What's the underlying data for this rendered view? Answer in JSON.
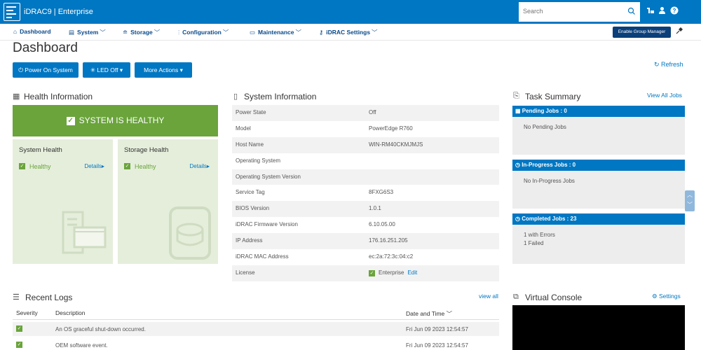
{
  "header": {
    "brand": "iDRAC9 | Enterprise",
    "search_placeholder": "Search"
  },
  "nav": [
    {
      "label": "Dashboard",
      "icon": "home-icon"
    },
    {
      "label": "System",
      "icon": "server-icon"
    },
    {
      "label": "Storage",
      "icon": "database-icon"
    },
    {
      "label": "Configuration",
      "icon": "sliders-icon"
    },
    {
      "label": "Maintenance",
      "icon": "monitor-icon"
    },
    {
      "label": "iDRAC Settings",
      "icon": "key-icon"
    }
  ],
  "enable_group_manager": "Enable Group Manager",
  "page_title": "Dashboard",
  "actions": {
    "power": "Power On System",
    "led": "LED Off",
    "more": "More Actions",
    "refresh": "Refresh"
  },
  "health": {
    "title": "Health Information",
    "banner": "SYSTEM IS HEALTHY",
    "system_health": {
      "title": "System Health",
      "status": "Healthy",
      "details": "Details"
    },
    "storage_health": {
      "title": "Storage Health",
      "status": "Healthy",
      "details": "Details"
    }
  },
  "system_info": {
    "title": "System Information",
    "rows": [
      {
        "key": "Power State",
        "value": "Off"
      },
      {
        "key": "Model",
        "value": "PowerEdge R760"
      },
      {
        "key": "Host Name",
        "value": "WIN-RM40CKMJMJS"
      },
      {
        "key": "Operating System",
        "value": ""
      },
      {
        "key": "Operating System Version",
        "value": ""
      },
      {
        "key": "Service Tag",
        "value": "8FXG6S3"
      },
      {
        "key": "BIOS Version",
        "value": "1.0.1"
      },
      {
        "key": "iDRAC Firmware Version",
        "value": "6.10.05.00"
      },
      {
        "key": "IP Address",
        "value": "176.16.251.205"
      },
      {
        "key": "iDRAC MAC Address",
        "value": "ec:2a:72:3c:04:c2"
      }
    ],
    "license_key": "License",
    "license_value": "Enterprise",
    "license_edit": "Edit"
  },
  "tasks": {
    "title": "Task Summary",
    "view_all": "View All Jobs",
    "pending_title": "Pending Jobs : 0",
    "pending_body": "No Pending Jobs",
    "inprogress_title": "In-Progress Jobs : 0",
    "inprogress_body": "No In-Progress Jobs",
    "completed_title": "Completed Jobs : 23",
    "completed_line1": "1 with Errors",
    "completed_line2": "1 Failed"
  },
  "logs": {
    "title": "Recent Logs",
    "view_all": "view all",
    "col_severity": "Severity",
    "col_description": "Description",
    "col_datetime": "Date and Time",
    "rows": [
      {
        "description": "An OS graceful shut-down occurred.",
        "datetime": "Fri Jun 09 2023 12:54:57"
      },
      {
        "description": "OEM software event.",
        "datetime": "Fri Jun 09 2023 12:54:57"
      }
    ]
  },
  "console": {
    "title": "Virtual Console",
    "settings": "Settings"
  }
}
